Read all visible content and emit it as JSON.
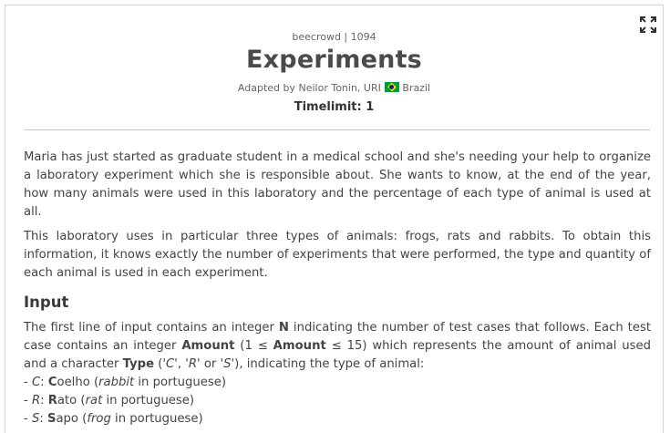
{
  "header": {
    "source": "beecrowd | 1094",
    "title": "Experiments",
    "adapted_prefix": "Adapted by Neilor Tonin, URI",
    "adapted_country": "Brazil",
    "timelimit": "Timelimit: 1"
  },
  "description": {
    "p1": "Maria has just started as graduate student in a medical school and she's needing your help to organize a laboratory experiment which she is responsible about. She wants to know, at the end of the year, how many animals were used in this laboratory and the percentage of each type of animal is used at all.",
    "p2": "This laboratory uses in particular three types of animals: frogs, rats and rabbits. To obtain this information, it knows exactly the number of experiments that were performed, the type and quantity of each animal is used in each experiment."
  },
  "input": {
    "heading": "Input",
    "t1": "The first line of input contains an integer ",
    "t1_bold": "N",
    "t2": " indicating the number of test cases that follows. Each test case contains an integer ",
    "t2_bold": "Amount",
    "t3": " (1 ≤ ",
    "t3_bold": "Amount",
    "t4": " ≤ 15) which represents the amount of animal used and a character ",
    "t4_bold": "Type",
    "t5": " ('",
    "c_letter": "C",
    "t6": "', '",
    "r_letter": "R",
    "t7": "' or '",
    "s_letter": "S",
    "t8": "'), indicating the type of animal:",
    "items": [
      {
        "prefix": "- ",
        "code": "C",
        "sep": ": ",
        "bold": "C",
        "rest": "oelho (",
        "italic": "rabbit",
        "suffix": " in portuguese)"
      },
      {
        "prefix": "- ",
        "code": "R",
        "sep": ": ",
        "bold": "R",
        "rest": "ato (",
        "italic": "rat",
        "suffix": "  in portuguese)"
      },
      {
        "prefix": "- ",
        "code": "S",
        "sep": ": ",
        "bold": "S",
        "rest": "apo (",
        "italic": "frog",
        "suffix": " in portuguese)"
      }
    ]
  },
  "icons": {
    "expand": "expand-icon",
    "flag": "brazil-flag-icon"
  }
}
